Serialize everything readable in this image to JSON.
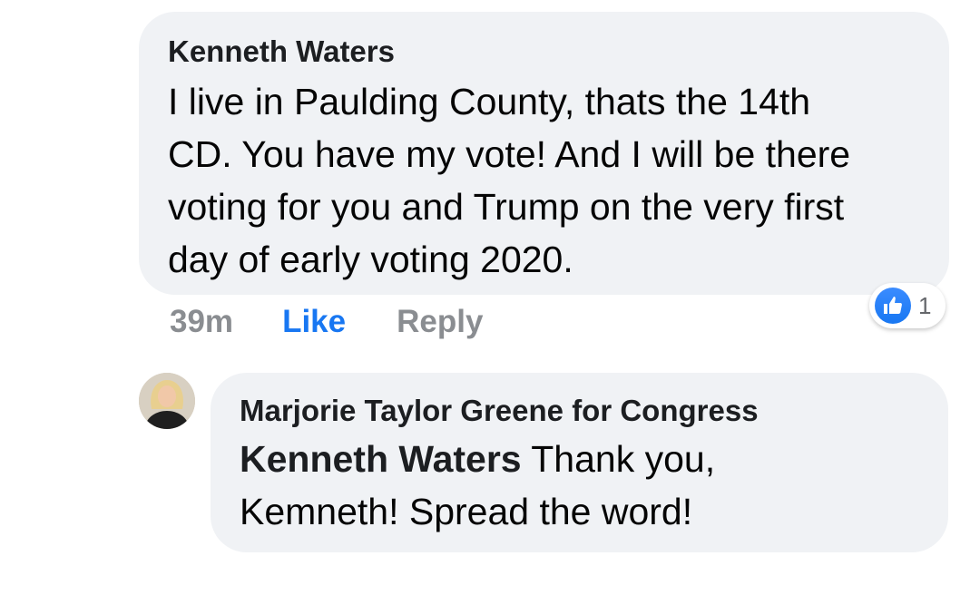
{
  "comment": {
    "author": "Kenneth Waters",
    "text_lines": [
      "I live in Paulding County, thats the 14th",
      "CD. You have my vote! And I will be there",
      "voting for you and Trump on the very first",
      "day of early voting 2020."
    ],
    "time": "39m",
    "like_label": "Like",
    "reply_label": "Reply",
    "reaction_count": "1",
    "reaction_icon": "thumbs-up-icon"
  },
  "reply": {
    "author": "Marjorie Taylor Greene for Congress",
    "mention": "Kenneth Waters",
    "text_line1": " Thank you,",
    "text_line2": "Kemneth! Spread the word!",
    "avatar_icon": "avatar"
  },
  "colors": {
    "bubble": "#f0f2f5",
    "like_blue": "#1877f2",
    "meta_gray": "#8a8d91"
  }
}
